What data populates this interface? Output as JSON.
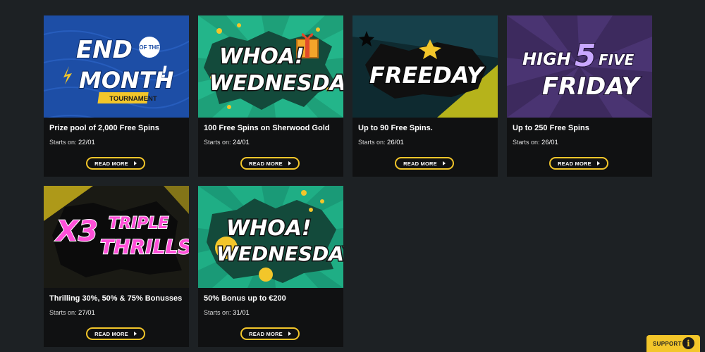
{
  "promotions": [
    {
      "banner_text": [
        "END",
        "OF THE",
        "MONTH",
        "!",
        "TOURNAMENT"
      ],
      "title": "Prize pool of 2,000 Free Spins",
      "starts_label": "Starts on:",
      "starts_date": "22/01",
      "button_label": "READ MORE"
    },
    {
      "banner_text": [
        "WHOA!",
        "WEDNESDAY"
      ],
      "title": "100 Free Spins on Sherwood Gold",
      "starts_label": "Starts on:",
      "starts_date": "24/01",
      "button_label": "READ MORE"
    },
    {
      "banner_text": [
        "FREEDAY"
      ],
      "title": "Up to 90 Free Spins.",
      "starts_label": "Starts on:",
      "starts_date": "26/01",
      "button_label": "READ MORE"
    },
    {
      "banner_text": [
        "HIGH",
        "5",
        "FIVE",
        "FRIDAY"
      ],
      "title": "Up to 250 Free Spins",
      "starts_label": "Starts on:",
      "starts_date": "26/01",
      "button_label": "READ MORE"
    },
    {
      "banner_text": [
        "X3",
        "TRIPLE",
        "THRILLS"
      ],
      "title": "Thrilling 30%, 50% & 75% Bonusses",
      "starts_label": "Starts on:",
      "starts_date": "27/01",
      "button_label": "READ MORE"
    },
    {
      "banner_text": [
        "WHOA!",
        "WEDNESDAY"
      ],
      "title": "50% Bonus up to €200",
      "starts_label": "Starts on:",
      "starts_date": "31/01",
      "button_label": "READ MORE"
    }
  ],
  "support": {
    "label": "SUPPORT",
    "icon": "info-icon"
  },
  "colors": {
    "accent": "#f3c62a",
    "page_background": "#1d2124",
    "card_background": "#101112"
  }
}
